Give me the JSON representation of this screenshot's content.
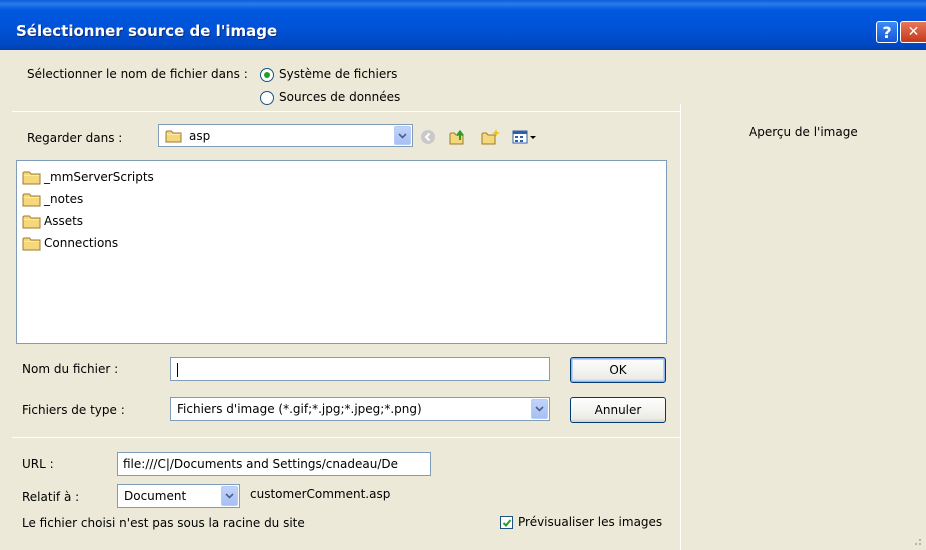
{
  "dialog": {
    "title": "Sélectionner source de l'image",
    "help_glyph": "?",
    "close_glyph": "✕"
  },
  "source": {
    "label": "Sélectionner le nom de fichier dans :",
    "options": [
      {
        "label": "Système de fichiers",
        "selected": true
      },
      {
        "label": "Sources de données",
        "selected": false
      }
    ]
  },
  "lookin": {
    "label": "Regarder dans :",
    "value": "asp",
    "toolbar": [
      "back-icon",
      "up-folder-icon",
      "new-folder-icon",
      "view-menu-icon"
    ]
  },
  "files": [
    {
      "name": "_mmServerScripts",
      "icon": "folder-icon"
    },
    {
      "name": "_notes",
      "icon": "folder-icon"
    },
    {
      "name": "Assets",
      "icon": "folder-icon"
    },
    {
      "name": "Connections",
      "icon": "folder-icon"
    }
  ],
  "filename": {
    "label": "Nom du fichier :",
    "value": ""
  },
  "filetype": {
    "label": "Fichiers de type :",
    "value": "Fichiers d'image (*.gif;*.jpg;*.jpeg;*.png)"
  },
  "buttons": {
    "ok": "OK",
    "cancel": "Annuler"
  },
  "url": {
    "label": "URL :",
    "value": "file:///C|/Documents and Settings/cnadeau/De"
  },
  "relative": {
    "label": "Relatif à :",
    "value": "Document",
    "file": "customerComment.asp"
  },
  "note": "Le fichier choisi n'est pas sous la racine du site",
  "preview": {
    "checkbox_label": "Prévisualiser les images",
    "checked": true,
    "title": "Aperçu de l'image"
  },
  "colors": {
    "titlebar": "#0052D6",
    "dialog_bg": "#ECE9D8",
    "radio_dot": "#21A121",
    "folder": "#F5D77C"
  }
}
